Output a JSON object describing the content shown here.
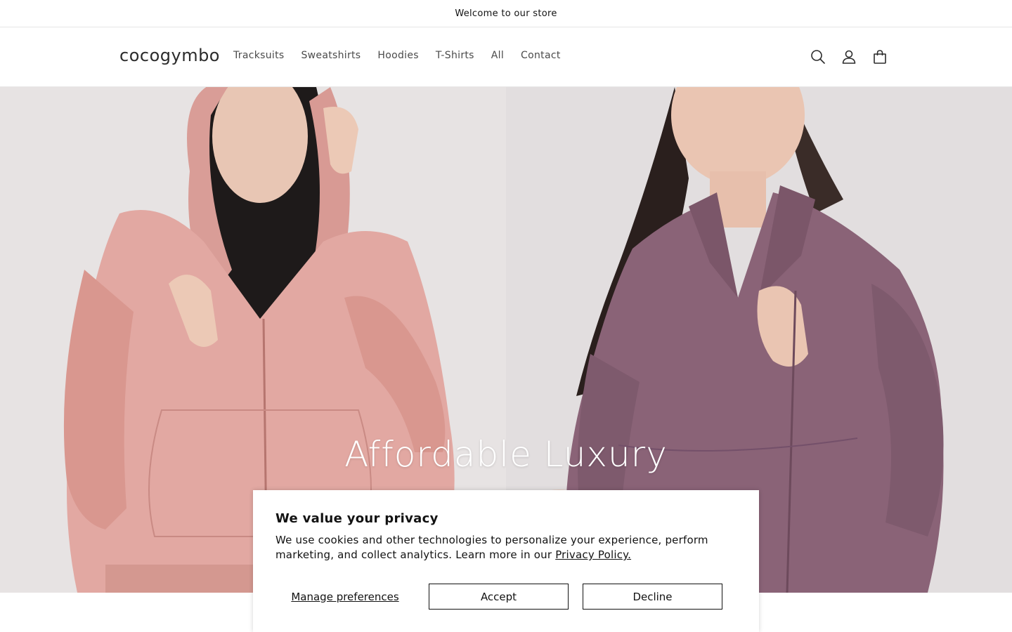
{
  "announcement": {
    "text": "Welcome to our store"
  },
  "header": {
    "logo": "cocogymbo",
    "nav": [
      "Tracksuits",
      "Sweatshirts",
      "Hoodies",
      "T-Shirts",
      "All",
      "Contact"
    ],
    "icons": [
      "search-icon",
      "account-icon",
      "cart-icon"
    ]
  },
  "hero": {
    "title": "Affordable Luxury",
    "left_jacket_color": "#e2a8a2",
    "right_jacket_color": "#8a6377"
  },
  "consent": {
    "title": "We value your privacy",
    "body": "We use cookies and other technologies to personalize your experience, perform marketing, and collect analytics. Learn more in our ",
    "link": "Privacy Policy.",
    "manage": "Manage preferences",
    "accept": "Accept",
    "decline": "Decline"
  }
}
